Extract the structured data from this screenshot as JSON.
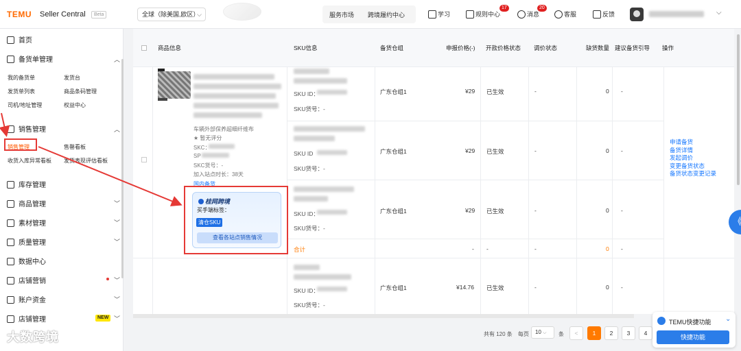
{
  "header": {
    "brand": "TEMU",
    "brand_sub": "Seller Central",
    "beta": "Beta",
    "region": "全球（除美国,欧区）",
    "nav_center": [
      "服务市场",
      "跨境履约中心"
    ],
    "nav": [
      {
        "label": "学习",
        "icon": "book-icon"
      },
      {
        "label": "规则中心",
        "icon": "rules-icon",
        "badge": "17"
      },
      {
        "label": "消息",
        "icon": "bell-icon",
        "badge": "20"
      },
      {
        "label": "客服",
        "icon": "headset-icon"
      },
      {
        "label": "反馈",
        "icon": "feedback-icon"
      }
    ]
  },
  "sidebar": {
    "menus": [
      {
        "label": "首页",
        "icon": "home-icon"
      },
      {
        "label": "备货单管理",
        "icon": "order-icon",
        "chevron": "up"
      },
      {
        "label": "销售管理",
        "icon": "sales-icon",
        "chevron": "up"
      },
      {
        "label": "库存管理",
        "icon": "stock-icon"
      },
      {
        "label": "商品管理",
        "icon": "goods-icon",
        "chevron": "down"
      },
      {
        "label": "素材管理",
        "icon": "material-icon",
        "chevron": "down"
      },
      {
        "label": "质量管理",
        "icon": "quality-icon",
        "chevron": "down"
      },
      {
        "label": "数据中心",
        "icon": "data-icon"
      },
      {
        "label": "店铺营销",
        "icon": "marketing-icon",
        "chevron": "down"
      },
      {
        "label": "账户资金",
        "icon": "wallet-icon",
        "chevron": "down"
      },
      {
        "label": "店铺管理",
        "icon": "shop-icon",
        "chevron": "down",
        "badge": "NEW"
      }
    ],
    "order_subs": [
      "我的备货单",
      "发货台",
      "发货单列表",
      "商品条码管理",
      "司机/地址管理",
      "权益中心"
    ],
    "sales_subs": [
      "销售管理",
      "售罄看板",
      "收货入库异常看板",
      "发货表现评估看板"
    ],
    "watermark": "大数跨境"
  },
  "table": {
    "headers": [
      "商品信息",
      "SKU信息",
      "备货仓组",
      "申报价格(-)",
      "开款价格状态",
      "调价状态",
      "缺货数量",
      "建议备货引导",
      "操作"
    ],
    "product": {
      "line1": "车辆外部保养超细纤维布",
      "line2": "★ 暂无评分",
      "skc": "SKC：",
      "spu": "SP",
      "skc_code": "SKC货号：-",
      "time": "加入站点时长：38天",
      "domestic": "国内备货"
    },
    "sku_rows": [
      {
        "sku_id": "SKU ID：",
        "sku_code": "SKU货号：-",
        "warehouse": "广东仓组1",
        "price": "¥29",
        "status": "已生效",
        "adjust": "-",
        "stock": "0",
        "suggest": "-"
      },
      {
        "sku_id": "SKU ID",
        "sku_code": "SKU货号：-",
        "warehouse": "广东仓组1",
        "price": "¥29",
        "status": "已生效",
        "adjust": "-",
        "stock": "0",
        "suggest": "-"
      },
      {
        "sku_id": "SKU ID：",
        "sku_code": "SKU货号：-",
        "warehouse": "广东仓组1",
        "price": "¥29",
        "status": "已生效",
        "adjust": "-",
        "stock": "0",
        "suggest": "-"
      }
    ],
    "total": {
      "label": "合计",
      "price": "-",
      "status": "-",
      "adjust": "-",
      "stock": "0",
      "suggest": "-"
    },
    "row2": {
      "sku_id": "SKU ID：",
      "sku_code": "SKU货号：-",
      "warehouse": "广东仓组1",
      "price": "¥14.76",
      "status": "已生效",
      "adjust": "-",
      "stock": "0",
      "suggest": "-"
    },
    "ops": [
      "申请备货",
      "备货详情",
      "发起调价",
      "变更备货状态",
      "备货状态变更记录"
    ]
  },
  "card": {
    "title": "桂网跨境",
    "label": "买手端标签：",
    "tag": "清仓SKU",
    "button": "查看各站点销售情况"
  },
  "pagination": {
    "total": "共有 120 条",
    "per_page": "每页",
    "size": "10",
    "unit": "条",
    "prev": "<",
    "pages": [
      "1",
      "2",
      "3",
      "4"
    ],
    "current": "1"
  },
  "quick": {
    "title": "TEMU快捷功能",
    "button": "快捷功能"
  },
  "colors": {
    "accent": "#ff7a00",
    "link": "#1677ff",
    "highlight": "#e53935",
    "primary": "#2b7de9"
  }
}
